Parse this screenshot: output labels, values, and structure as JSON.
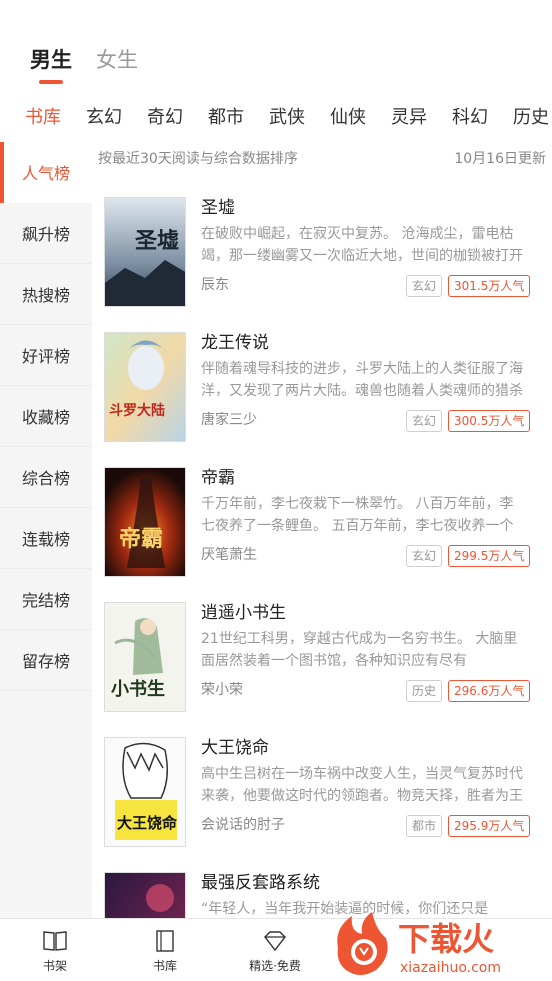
{
  "gender_tabs": [
    {
      "label": "男生",
      "active": true
    },
    {
      "label": "女生",
      "active": false
    }
  ],
  "categories": [
    "书库",
    "玄幻",
    "奇幻",
    "都市",
    "武侠",
    "仙侠",
    "灵异",
    "科幻",
    "历史"
  ],
  "sidebar": {
    "items": [
      "人气榜",
      "飙升榜",
      "热搜榜",
      "好评榜",
      "收藏榜",
      "综合榜",
      "连载榜",
      "完结榜",
      "留存榜"
    ]
  },
  "list_header": {
    "sort_desc": "按最近30天阅读与综合数据排序",
    "update": "10月16日更新"
  },
  "books": [
    {
      "title": "圣墟",
      "desc": "在破败中崛起，在寂灭中复苏。 沧海成尘，雷电枯竭，那一缕幽雾又一次临近大地，世间的枷锁被打开了",
      "author": "辰东",
      "genre": "玄幻",
      "popularity": "301.5万人气",
      "cover_text": "圣墟"
    },
    {
      "title": "龙王传说",
      "desc": "伴随着魂导科技的进步，斗罗大陆上的人类征服了海洋，又发现了两片大陆。魂兽也随着人类魂师的猎杀",
      "author": "唐家三少",
      "genre": "玄幻",
      "popularity": "300.5万人气",
      "cover_text": "斗罗大陆"
    },
    {
      "title": "帝霸",
      "desc": "千万年前，李七夜栽下一株翠竹。 八百万年前，李七夜养了一条鲤鱼。 五百万年前，李七夜收养一个小女孩",
      "author": "厌笔萧生",
      "genre": "玄幻",
      "popularity": "299.5万人气",
      "cover_text": "帝霸"
    },
    {
      "title": "逍遥小书生",
      "desc": "21世纪工科男，穿越古代成为一名穷书生。 大脑里面居然装着一个图书馆，各种知识应有尽有",
      "author": "荣小荣",
      "genre": "历史",
      "popularity": "296.6万人气",
      "cover_text": "小书生"
    },
    {
      "title": "大王饶命",
      "desc": "高中生吕树在一场车祸中改变人生，当灵气复苏时代来袭，他要做这时代的领跑者。物竞天择，胜者为王",
      "author": "会说话的肘子",
      "genre": "都市",
      "popularity": "295.9万人气",
      "cover_text": "大王饶命"
    },
    {
      "title": "最强反套路系统",
      "desc": "“年轻人，当年我开始装逼的时候，你们还只是",
      "author": "",
      "genre": "",
      "popularity": "",
      "cover_text": ""
    }
  ],
  "bottom_nav": [
    {
      "label": "书架",
      "icon": "bookshelf-icon"
    },
    {
      "label": "书库",
      "icon": "library-icon"
    },
    {
      "label": "精选·免费",
      "icon": "diamond-icon"
    }
  ],
  "watermark": {
    "brand": "下载火",
    "url": "xiazaihuo.com"
  },
  "colors": {
    "accent": "#ee5533",
    "sidebar_bg": "#f5f5f5"
  }
}
